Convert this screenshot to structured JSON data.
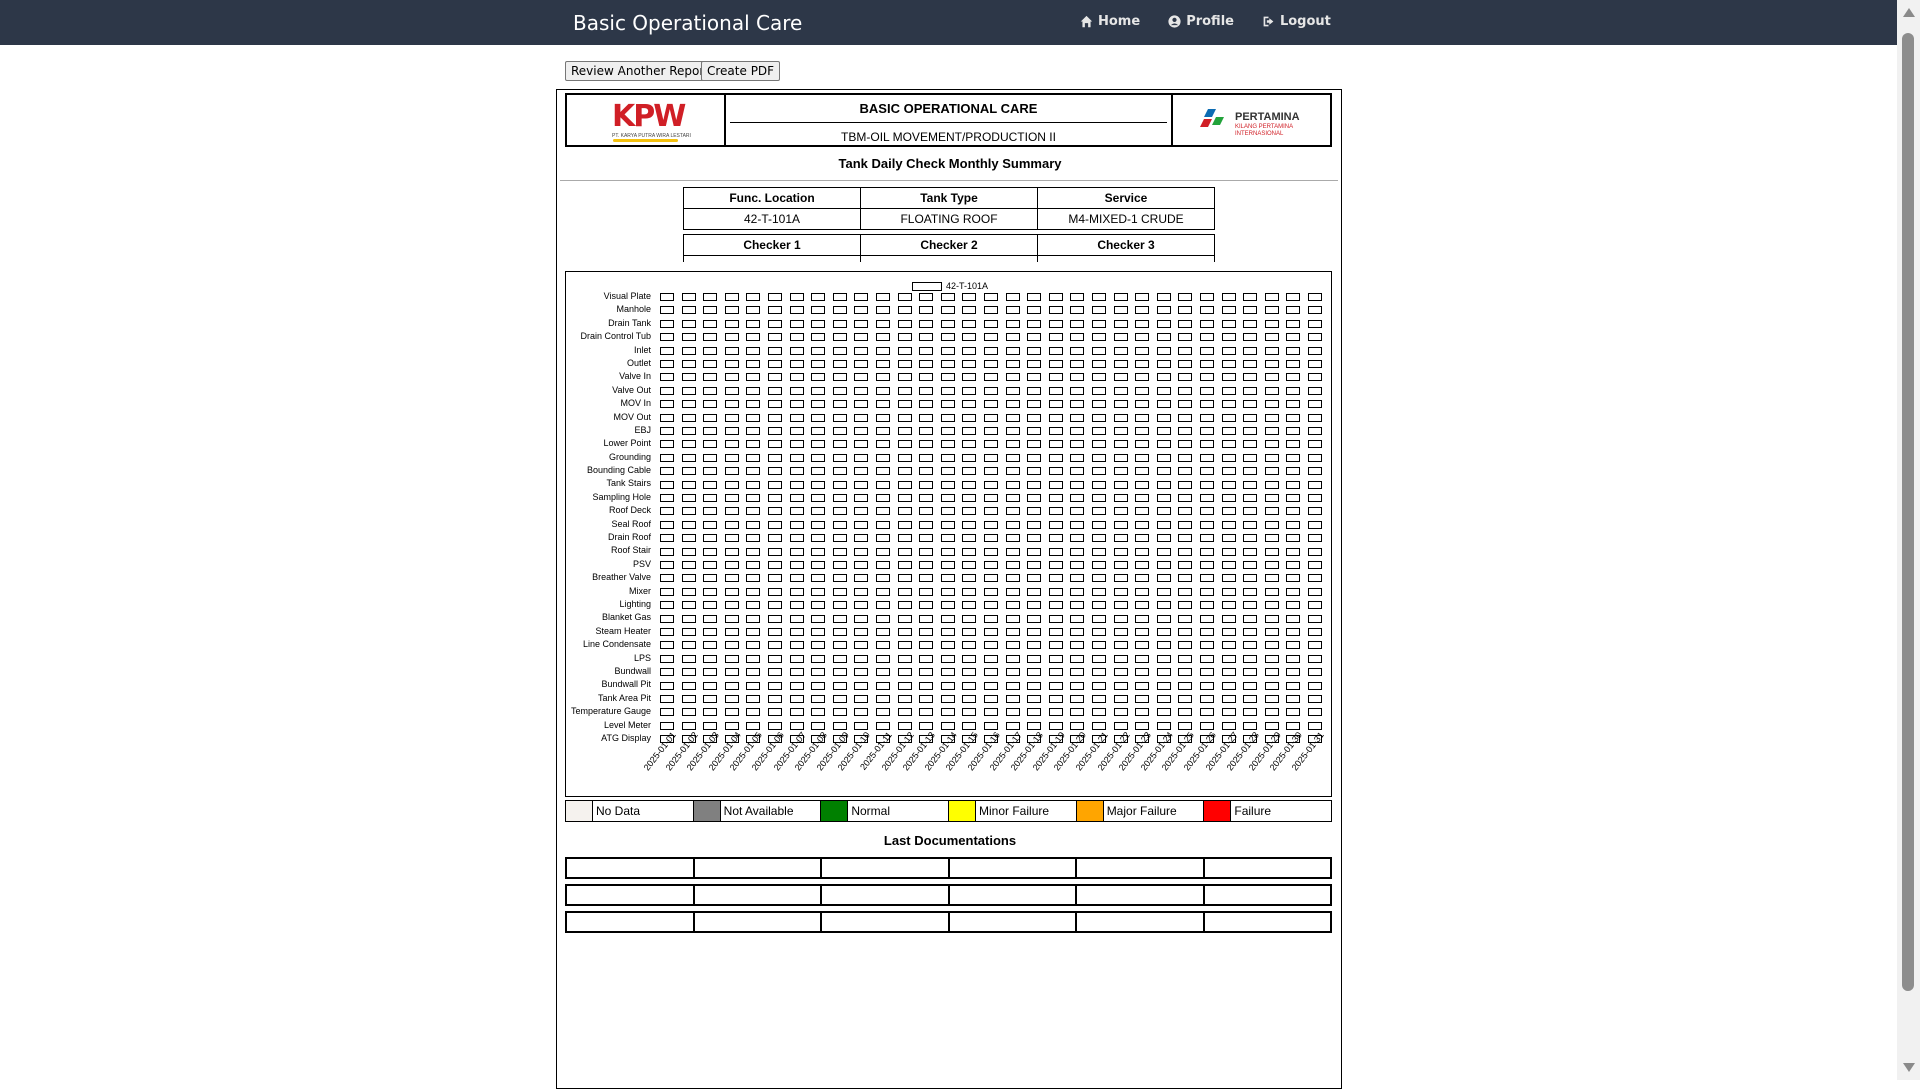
{
  "navbar": {
    "brand": "Basic Operational Care",
    "links": [
      {
        "label": "Home",
        "icon": "home-icon"
      },
      {
        "label": "Profile",
        "icon": "user-circle-icon"
      },
      {
        "label": "Logout",
        "icon": "sign-out-icon"
      }
    ]
  },
  "toolbar": {
    "review_label": "Review Another Report",
    "pdf_label": "Create PDF"
  },
  "report": {
    "header_title": "BASIC OPERATIONAL CARE",
    "header_subtitle": "TBM-OIL MOVEMENT/PRODUCTION II",
    "left_logo_text": "KPW",
    "left_logo_sub": "PT. KARYA PUTRA WIRA LESTARI",
    "right_logo_text": "PERTAMINA",
    "right_logo_sub": "KILANG PERTAMINA INTERNASIONAL",
    "title": "Tank Daily Check Monthly Summary",
    "info": {
      "headers": [
        "Func. Location",
        "Tank Type",
        "Service"
      ],
      "values": [
        "42-T-101A",
        "FLOATING ROOF",
        "M4-MIXED-1 CRUDE"
      ],
      "checker_headers": [
        "Checker 1",
        "Checker 2",
        "Checker 3"
      ]
    },
    "matrix": {
      "legend_label": "42-T-101A",
      "rows": [
        "Visual Plate",
        "Manhole",
        "Drain Tank",
        "Drain Control Tub",
        "Inlet",
        "Outlet",
        "Valve In",
        "Valve Out",
        "MOV In",
        "MOV Out",
        "EBJ",
        "Lower Point",
        "Grounding",
        "Bounding Cable",
        "Tank Stairs",
        "Sampling Hole",
        "Roof Deck",
        "Seal Roof",
        "Drain Roof",
        "Roof Stair",
        "PSV",
        "Breather Valve",
        "Mixer",
        "Lighting",
        "Blanket Gas",
        "Steam Heater",
        "Line Condensate",
        "LPS",
        "Bundwall",
        "Bundwall Pit",
        "Tank Area Pit",
        "Temperature Gauge",
        "Level Meter",
        "ATG Display"
      ],
      "dates": [
        "2025-01-01",
        "2025-01-02",
        "2025-01-03",
        "2025-01-04",
        "2025-01-05",
        "2025-01-06",
        "2025-01-07",
        "2025-01-08",
        "2025-01-09",
        "2025-01-10",
        "2025-01-11",
        "2025-01-12",
        "2025-01-13",
        "2025-01-14",
        "2025-01-15",
        "2025-01-16",
        "2025-01-17",
        "2025-01-18",
        "2025-01-19",
        "2025-01-20",
        "2025-01-21",
        "2025-01-22",
        "2025-01-23",
        "2025-01-24",
        "2025-01-25",
        "2025-01-26",
        "2025-01-27",
        "2025-01-28",
        "2025-01-29",
        "2025-01-30",
        "2025-01-31"
      ],
      "cell_status": "No Data"
    },
    "legend": [
      {
        "label": "No Data",
        "color": "#f5f2ee"
      },
      {
        "label": "Not Available",
        "color": "#808080"
      },
      {
        "label": "Normal",
        "color": "#008000"
      },
      {
        "label": "Minor Failure",
        "color": "#ffff00"
      },
      {
        "label": "Major Failure",
        "color": "#ffa500"
      },
      {
        "label": "Failure",
        "color": "#ff0000"
      }
    ],
    "last_documentations_title": "Last Documentations"
  }
}
